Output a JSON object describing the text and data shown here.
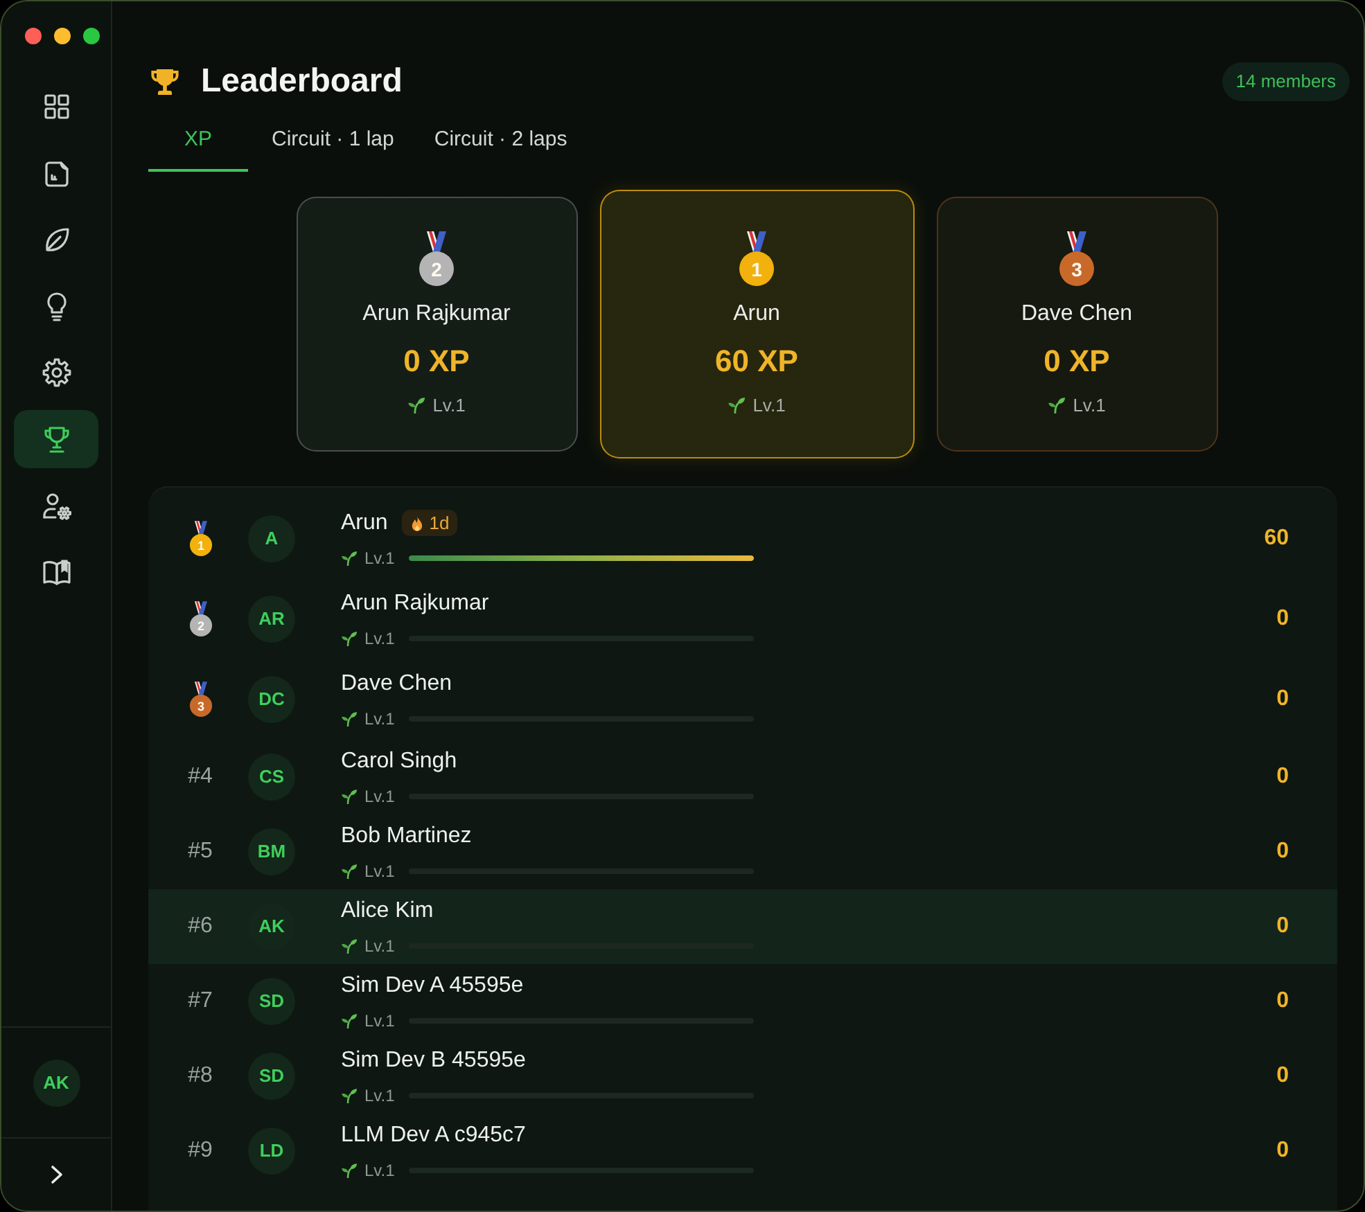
{
  "sidebar": {
    "items": [
      {
        "kind": "grid",
        "selected": false
      },
      {
        "kind": "journal",
        "selected": false
      },
      {
        "kind": "leaf",
        "selected": false
      },
      {
        "kind": "bulb",
        "selected": false
      },
      {
        "kind": "gear",
        "selected": false
      },
      {
        "kind": "trophy",
        "selected": true
      },
      {
        "kind": "user-gear",
        "selected": false
      },
      {
        "kind": "book",
        "selected": false
      }
    ],
    "user": {
      "initials": "AK"
    }
  },
  "header": {
    "title": "Leaderboard",
    "member_count": "14 members"
  },
  "tabs": [
    {
      "label": "XP",
      "selected": true
    },
    {
      "label": "Circuit · 1 lap",
      "selected": false
    },
    {
      "label": "Circuit · 2 laps",
      "selected": false
    }
  ],
  "podium": [
    {
      "color": "#b4b4b4",
      "featured": false,
      "rank": "2",
      "name": "Arun Rajkumar",
      "xp": "0 XP",
      "level_label": "Lv.1"
    },
    {
      "color": "#f2b10c",
      "featured": true,
      "rank": "1",
      "name": "Arun",
      "xp": "60 XP",
      "level_label": "Lv.1"
    },
    {
      "color": "#c8692a",
      "featured": false,
      "rank": "3",
      "name": "Dave Chen",
      "xp": "0 XP",
      "level_label": "Lv.1"
    }
  ],
  "rows": [
    {
      "kind": "medal",
      "color": "#f2b10c",
      "rank": "1",
      "initials": "A",
      "name": "Arun",
      "streak": "1d",
      "level_label": "Lv.1",
      "level": 1,
      "score": "60",
      "current_user": false
    },
    {
      "kind": "medal",
      "color": "#b4b4b4",
      "rank": "2",
      "initials": "AR",
      "name": "Arun Rajkumar",
      "level_label": "Lv.1",
      "level": 0,
      "score": "0",
      "current_user": false
    },
    {
      "kind": "medal",
      "color": "#c8692a",
      "rank": "3",
      "initials": "DC",
      "name": "Dave Chen",
      "level_label": "Lv.1",
      "level": 0,
      "score": "0",
      "current_user": false
    },
    {
      "kind": "number",
      "rank": "#4",
      "initials": "CS",
      "name": "Carol Singh",
      "level_label": "Lv.1",
      "level": 0,
      "score": "0",
      "current_user": false
    },
    {
      "kind": "number",
      "rank": "#5",
      "initials": "BM",
      "name": "Bob Martinez",
      "level_label": "Lv.1",
      "level": 0,
      "score": "0",
      "current_user": false
    },
    {
      "kind": "number",
      "rank": "#6",
      "initials": "AK",
      "name": "Alice Kim",
      "level_label": "Lv.1",
      "level": 0,
      "score": "0",
      "current_user": true
    },
    {
      "kind": "number",
      "rank": "#7",
      "initials": "SD",
      "name": "Sim Dev A 45595e",
      "level_label": "Lv.1",
      "level": 0,
      "score": "0",
      "current_user": false
    },
    {
      "kind": "number",
      "rank": "#8",
      "initials": "SD",
      "name": "Sim Dev B 45595e",
      "level_label": "Lv.1",
      "level": 0,
      "score": "0",
      "current_user": false
    },
    {
      "kind": "number",
      "rank": "#9",
      "initials": "LD",
      "name": "LLM Dev A c945c7",
      "level_label": "Lv.1",
      "level": 0,
      "score": "0",
      "current_user": false
    }
  ]
}
